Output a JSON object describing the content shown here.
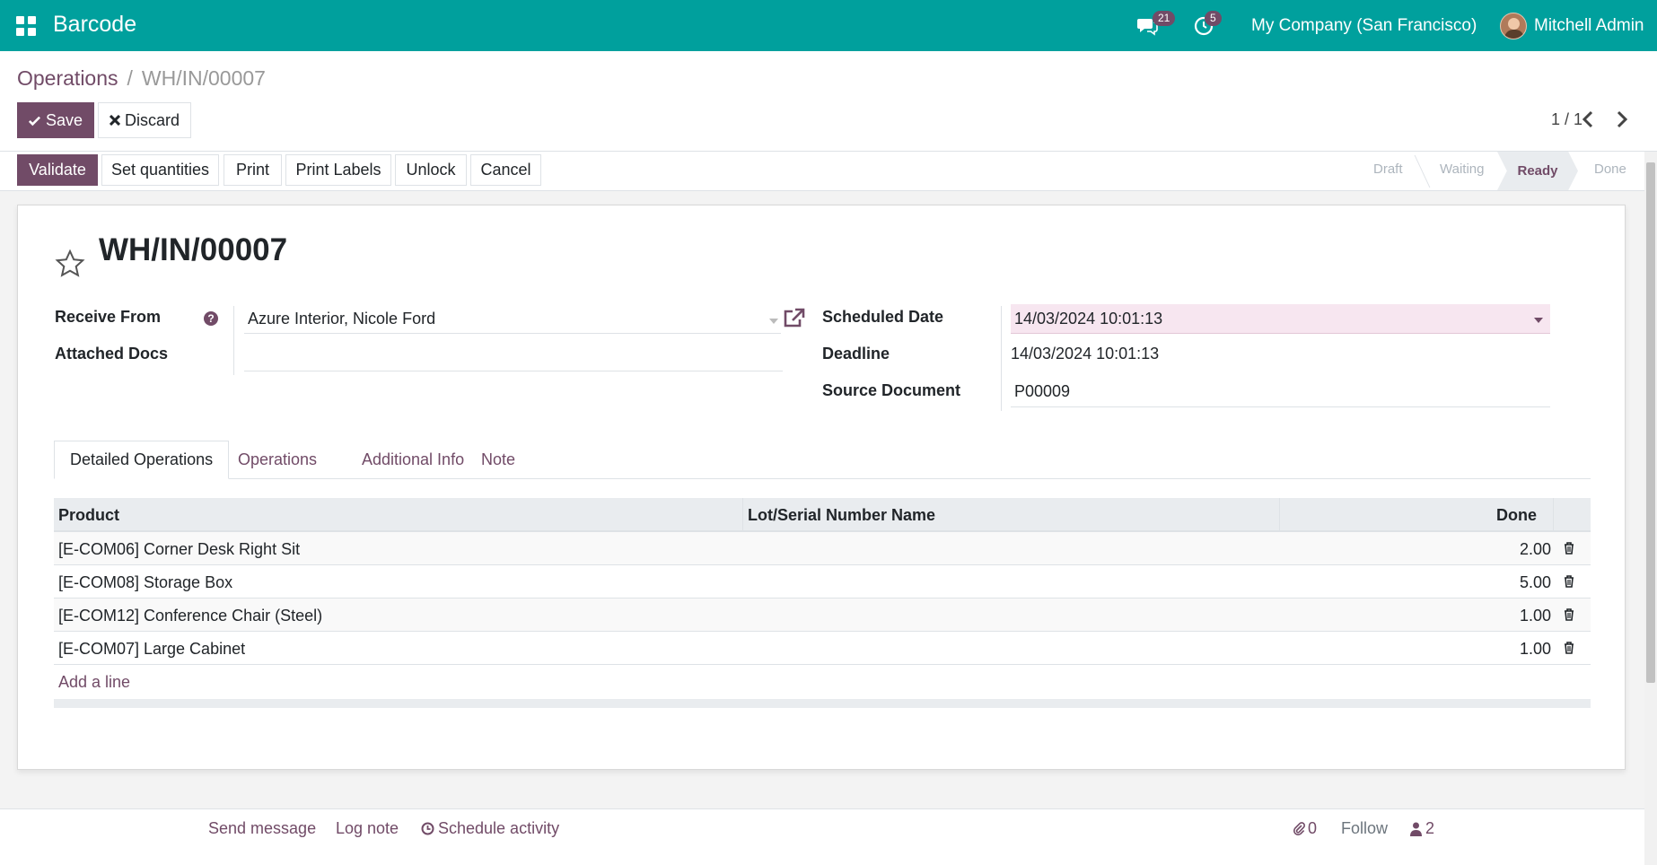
{
  "navbar": {
    "app_title": "Barcode",
    "messages_count": "21",
    "activities_count": "5",
    "company": "My Company (San Francisco)",
    "user": "Mitchell Admin",
    "bg_color": "#00a09d"
  },
  "breadcrumb": {
    "parent": "Operations",
    "separator": "/",
    "current": "WH/IN/00007"
  },
  "toolbar": {
    "save_label": "Save",
    "discard_label": "Discard",
    "pager": "1 / 1"
  },
  "actions": {
    "validate": "Validate",
    "set_quantities": "Set quantities",
    "print": "Print",
    "print_labels": "Print Labels",
    "unlock": "Unlock",
    "cancel": "Cancel"
  },
  "stages": {
    "draft": "Draft",
    "waiting": "Waiting",
    "ready": "Ready",
    "done": "Done",
    "active": "Ready"
  },
  "record": {
    "title": "WH/IN/00007",
    "receive_from_label": "Receive From",
    "receive_from_value": "Azure Interior, Nicole Ford",
    "attached_docs_label": "Attached Docs",
    "scheduled_date_label": "Scheduled Date",
    "scheduled_date_value": "14/03/2024 10:01:13",
    "deadline_label": "Deadline",
    "deadline_value": "14/03/2024 10:01:13",
    "source_document_label": "Source Document",
    "source_document_value": "P00009",
    "help_glyph": "?"
  },
  "tabs": [
    {
      "label": "Detailed Operations",
      "active": true
    },
    {
      "label": "Operations",
      "active": false
    },
    {
      "label": "Additional Info",
      "active": false
    },
    {
      "label": "Note",
      "active": false
    }
  ],
  "table": {
    "headers": {
      "product": "Product",
      "lot": "Lot/Serial Number Name",
      "done": "Done"
    },
    "rows": [
      {
        "product": "[E-COM06] Corner Desk Right Sit",
        "done": "2.00"
      },
      {
        "product": "[E-COM08] Storage Box",
        "done": "5.00"
      },
      {
        "product": "[E-COM12] Conference Chair (Steel)",
        "done": "1.00"
      },
      {
        "product": "[E-COM07] Large Cabinet",
        "done": "1.00"
      }
    ],
    "add_line": "Add a line"
  },
  "chatter": {
    "send_message": "Send message",
    "log_note": "Log note",
    "schedule_activity": "Schedule activity",
    "attachments_count": "0",
    "follow": "Follow",
    "followers_count": "2"
  },
  "colors": {
    "primary": "#714b67",
    "teal": "#00a09d"
  }
}
